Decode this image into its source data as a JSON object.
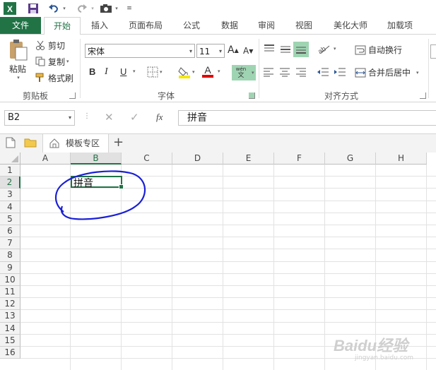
{
  "qat": {
    "items": [
      "excel-logo-icon",
      "save-icon",
      "undo-icon",
      "redo-icon",
      "camera-icon",
      "customize-qat-icon"
    ]
  },
  "tabs": [
    {
      "label": "文件",
      "state": "file"
    },
    {
      "label": "开始",
      "state": "active"
    },
    {
      "label": "插入",
      "state": ""
    },
    {
      "label": "页面布局",
      "state": ""
    },
    {
      "label": "公式",
      "state": ""
    },
    {
      "label": "数据",
      "state": ""
    },
    {
      "label": "审阅",
      "state": ""
    },
    {
      "label": "视图",
      "state": ""
    },
    {
      "label": "美化大师",
      "state": ""
    },
    {
      "label": "加载项",
      "state": ""
    }
  ],
  "ribbon": {
    "clipboard": {
      "paste": "粘贴",
      "cut": "剪切",
      "copy": "复制",
      "format_painter": "格式刷",
      "group_label": "剪贴板"
    },
    "font": {
      "font_name": "宋体",
      "font_size": "11",
      "bold": "B",
      "italic": "I",
      "underline": "U",
      "phonetic_top": "wén",
      "phonetic_bottom": "文",
      "group_label": "字体"
    },
    "alignment": {
      "wrap_text": "自动换行",
      "merge_center": "合并后居中",
      "group_label": "对齐方式"
    }
  },
  "formula_bar": {
    "name_box": "B2",
    "fx": "fx",
    "formula": "拼音"
  },
  "sheet_tabs": {
    "template_zone": "模板专区",
    "add": "+"
  },
  "grid": {
    "columns": [
      "A",
      "B",
      "C",
      "D",
      "E",
      "F",
      "G",
      "H"
    ],
    "rows": [
      "1",
      "2",
      "3",
      "4",
      "5",
      "6",
      "7",
      "8",
      "9",
      "10",
      "11",
      "12",
      "13",
      "14",
      "15",
      "16"
    ],
    "selected_cell": "B2",
    "cells": {
      "B2": "拼音"
    }
  },
  "annotation": {
    "color": "#1a1fd6",
    "shape": "hand-drawn circle around B2"
  },
  "watermark": {
    "text": "Baidu经验",
    "sub": "jingyan.baidu.com"
  },
  "colors": {
    "accent": "#217346",
    "highlight_fill": "#f5e800",
    "font_red": "#e00000"
  }
}
